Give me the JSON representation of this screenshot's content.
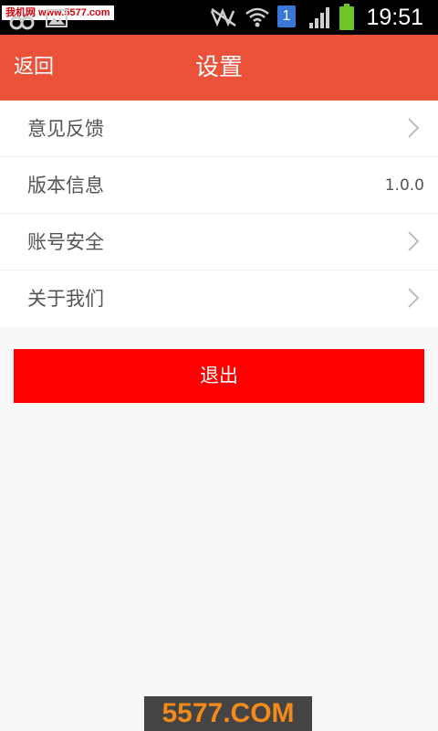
{
  "status_bar": {
    "watermark": "我机网 www.5577.com",
    "sim_label": "1",
    "time": "19:51",
    "icons": [
      "link-icon",
      "image-icon",
      "mute-icon",
      "wifi-icon",
      "sim-card-icon",
      "signal-icon",
      "battery-icon"
    ],
    "battery_color": "#6ec52a"
  },
  "header": {
    "back_label": "返回",
    "title": "设置",
    "color": "#ec513a"
  },
  "settings": {
    "items": [
      {
        "label": "意见反馈",
        "value": ""
      },
      {
        "label": "版本信息",
        "value": "1.0.0"
      },
      {
        "label": "账号安全",
        "value": ""
      },
      {
        "label": "关于我们",
        "value": ""
      }
    ]
  },
  "logout": {
    "label": "退出",
    "color": "#ff0000"
  },
  "watermark": {
    "text": "5577.COM"
  }
}
